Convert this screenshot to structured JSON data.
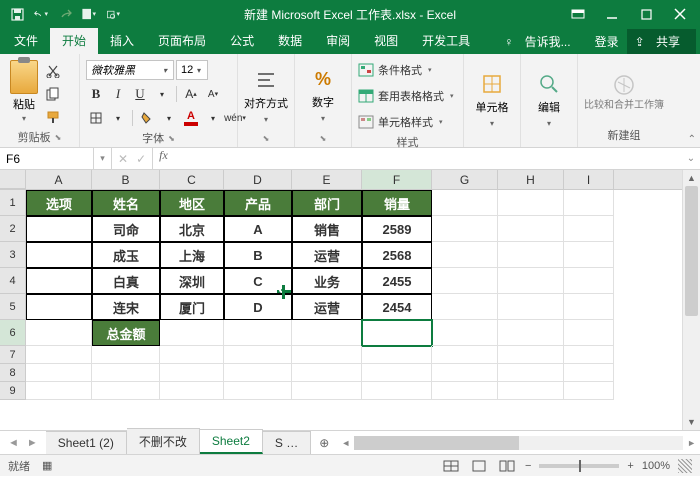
{
  "title": "新建 Microsoft Excel 工作表.xlsx - Excel",
  "qat": {
    "save": "save-icon",
    "undo": "undo-icon",
    "redo": "redo-icon",
    "new": "new-icon",
    "print": "print-icon"
  },
  "tabs": {
    "file": "文件",
    "home": "开始",
    "insert": "插入",
    "layout": "页面布局",
    "formulas": "公式",
    "data": "数据",
    "review": "审阅",
    "view": "视图",
    "dev": "开发工具",
    "tell": "告诉我...",
    "login": "登录",
    "share": "共享"
  },
  "ribbon": {
    "clipboard": {
      "paste": "粘贴",
      "label": "剪贴板"
    },
    "font": {
      "name": "微软雅黑",
      "size": "12",
      "label": "字体"
    },
    "align": {
      "label": "对齐方式"
    },
    "number": {
      "label": "数字"
    },
    "styles": {
      "cond": "条件格式",
      "table": "套用表格格式",
      "cell": "单元格样式",
      "label": "样式"
    },
    "cells": {
      "label": "单元格"
    },
    "editing": {
      "label": "编辑"
    },
    "newgroup": {
      "compare": "比较和合并工作簿",
      "label": "新建组"
    }
  },
  "namebox": "F6",
  "fx": "fx",
  "columns": [
    "A",
    "B",
    "C",
    "D",
    "E",
    "F",
    "G",
    "H",
    "I"
  ],
  "rows": [
    "1",
    "2",
    "3",
    "4",
    "5",
    "6",
    "7",
    "8",
    "9"
  ],
  "table": {
    "headers": [
      "选项",
      "姓名",
      "地区",
      "产品",
      "部门",
      "销量"
    ],
    "rows": [
      [
        "",
        "司命",
        "北京",
        "A",
        "销售",
        "2589"
      ],
      [
        "",
        "成玉",
        "上海",
        "B",
        "运营",
        "2568"
      ],
      [
        "",
        "白真",
        "深圳",
        "C",
        "业务",
        "2455"
      ],
      [
        "",
        "连宋",
        "厦门",
        "D",
        "运营",
        "2454"
      ]
    ],
    "total_label": "总金额"
  },
  "sheets": {
    "s1": "Sheet1 (2)",
    "s2": "不删不改",
    "s3": "Sheet2",
    "s4": "S"
  },
  "status": {
    "ready": "就绪",
    "macros": "",
    "zoom": "100%"
  }
}
